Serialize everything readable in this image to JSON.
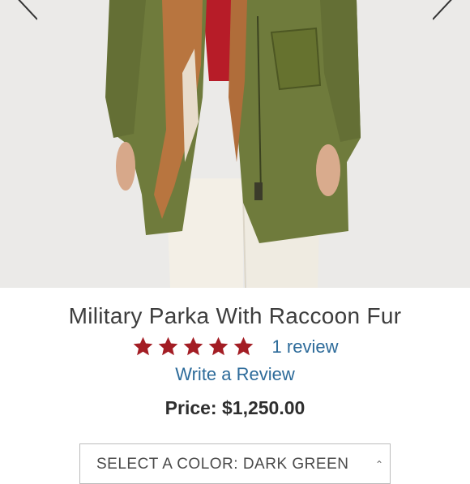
{
  "product": {
    "title": "Military Parka With Raccoon Fur",
    "rating": {
      "stars": 5,
      "max": 5,
      "star_color": "#a31d24"
    },
    "review_count_label": "1 review",
    "write_review_label": "Write a Review",
    "price_label": "Price:",
    "price_value": "$1,250.00"
  },
  "color_selector": {
    "label": "SELECT A COLOR: DARK GREEN"
  },
  "gallery": {
    "prev_icon": "chevron-left-icon",
    "next_icon": "chevron-right-icon"
  },
  "colors": {
    "link": "#2d6b9a",
    "parka": "#6f7b3c",
    "fur": "#b8753f",
    "sweater": "#b71c28",
    "trousers": "#f1ede4"
  }
}
